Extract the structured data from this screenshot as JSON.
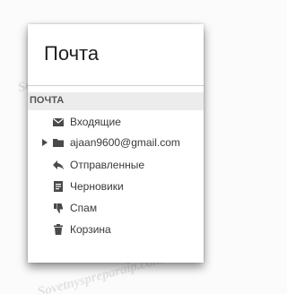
{
  "mail": {
    "title": "Почта",
    "section": "ПОЧТА",
    "folders": [
      {
        "label": "Входящие",
        "icon": "envelope-icon"
      },
      {
        "label": "ajaan9600@gmail.com",
        "icon": "folder-icon",
        "expandable": true
      },
      {
        "label": "Отправленные",
        "icon": "reply-arrow-icon"
      },
      {
        "label": "Черновики",
        "icon": "document-icon"
      },
      {
        "label": "Спам",
        "icon": "thumbs-down-icon"
      },
      {
        "label": "Корзина",
        "icon": "trash-icon"
      }
    ]
  },
  "watermark": {
    "text": "Sovetnyspreparaip.com"
  }
}
